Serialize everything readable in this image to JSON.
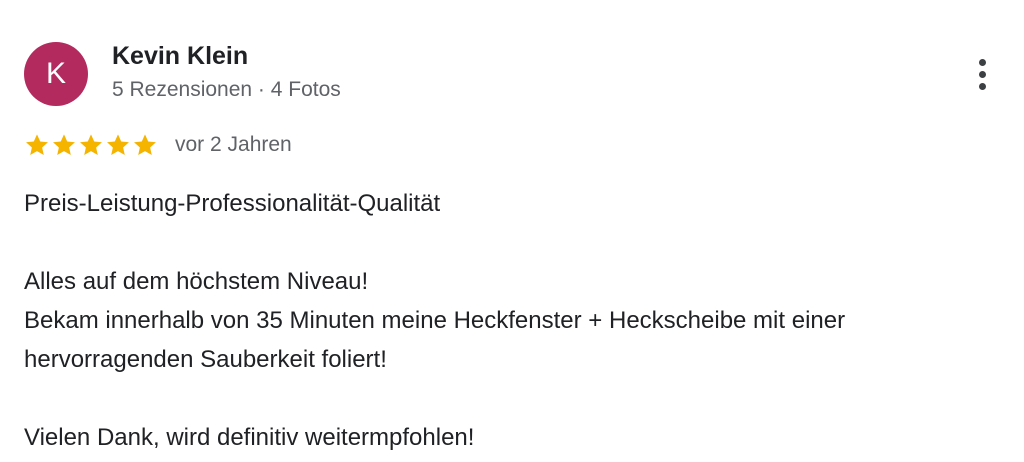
{
  "reviewer": {
    "initial": "K",
    "avatar_color": "#b32a5e",
    "name": "Kevin Klein",
    "meta": "5 Rezensionen · 4 Fotos"
  },
  "menu": {
    "icon": "more-vert-icon"
  },
  "rating": {
    "stars": 5,
    "max": 5,
    "star_color": "#f4b400",
    "date": "vor 2 Jahren"
  },
  "review": {
    "line1": "Preis-Leistung-Professionalität-Qualität",
    "line2": "Alles auf dem höchstem Niveau!",
    "line3": "Bekam innerhalb von 35 Minuten meine Heckfenster + Heckscheibe mit einer",
    "line4": "hervorragenden Sauberkeit foliert!",
    "line5": "Vielen Dank, wird definitiv weitermpfohlen!"
  }
}
